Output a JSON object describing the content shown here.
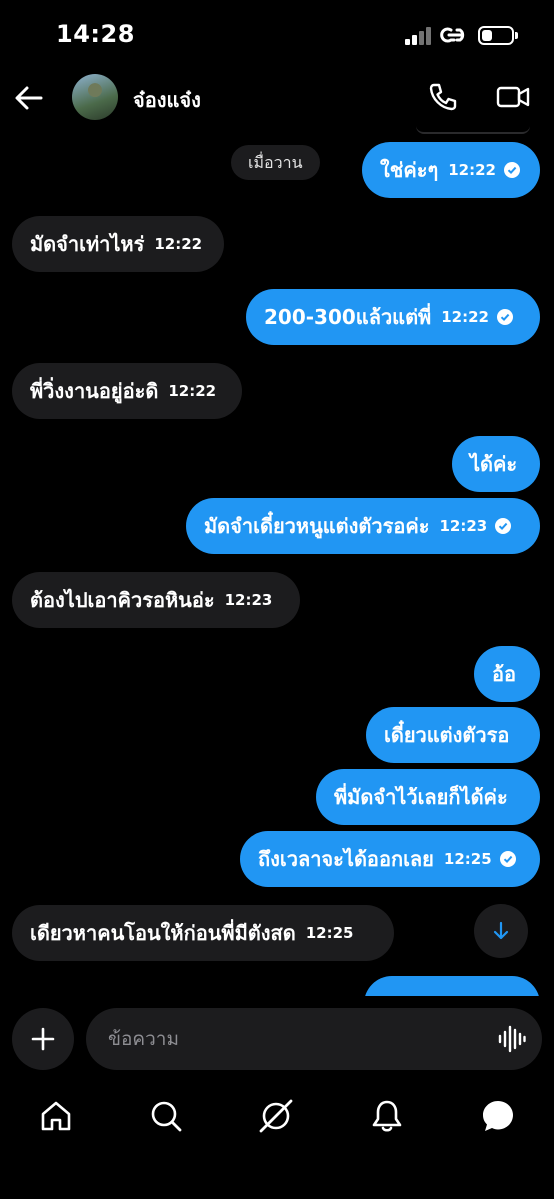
{
  "status_bar": {
    "time": "14:28"
  },
  "header": {
    "contact_name": "จ๋องแจ๋ง"
  },
  "chat": {
    "date_chip": "เมื่อวาน",
    "messages": [
      {
        "dir": "out",
        "text": "ใช่ค่ะๆ",
        "time": "12:22",
        "read": true
      },
      {
        "dir": "in",
        "text": "มัดจำเท่าไหร่",
        "time": "12:22"
      },
      {
        "dir": "out",
        "text": "200-300แล้วแต่พี่",
        "time": "12:22",
        "read": true
      },
      {
        "dir": "in",
        "text": "พี่วิ่งงานอยู่อ่ะดิ",
        "time": "12:22"
      },
      {
        "dir": "out",
        "text": "ได้ค่ะ"
      },
      {
        "dir": "out",
        "text": "มัดจำเดี๋ยวหนูแต่งตัวรอค่ะ",
        "time": "12:23",
        "read": true
      },
      {
        "dir": "in",
        "text": "ต้องไปเอาคิวรอหินอ่ะ",
        "time": "12:23"
      },
      {
        "dir": "out",
        "text": "อ้อ"
      },
      {
        "dir": "out",
        "text": "เดี๋ยวแต่งตัวรอ"
      },
      {
        "dir": "out",
        "text": "พี่มัดจำไว้เลยก็ได้ค่ะ"
      },
      {
        "dir": "out",
        "text": "ถึงเวลาจะได้ออกเลย",
        "time": "12:25",
        "read": true
      },
      {
        "dir": "in",
        "text": "เดียวหาคนโอนให้ก่อนพี่มีตังสด",
        "time": "12:25"
      }
    ]
  },
  "composer": {
    "placeholder": "ข้อความ"
  },
  "icons": {
    "back": "arrow-left-icon",
    "call": "phone-icon",
    "video": "video-camera-icon",
    "scroll": "arrow-down-icon",
    "add": "plus-icon",
    "voice": "waveform-icon",
    "nav": [
      "home-icon",
      "search-icon",
      "explore-icon",
      "bell-icon",
      "chat-bubble-icon"
    ]
  },
  "colors": {
    "outgoing": "#2196f3",
    "incoming": "#1c1c1e",
    "background": "#000000"
  }
}
